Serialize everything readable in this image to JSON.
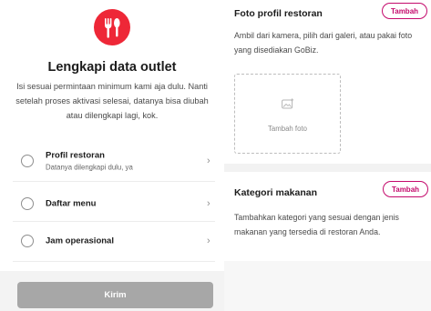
{
  "brand": {
    "accent": "#ee2737",
    "pill_color": "#c40a6c",
    "button_disabled": "#a7a7a7",
    "logo_icon": "fork-spoon-icon"
  },
  "left": {
    "title": "Lengkapi data outlet",
    "description": "Isi sesuai permintaan minimum kami aja dulu. Nanti setelah proses aktivasi selesai, datanya bisa diubah atau dilengkapi lagi, kok.",
    "items": [
      {
        "label": "Profil restoran",
        "sublabel": "Datanya dilengkapi dulu, ya",
        "chevron": "›"
      },
      {
        "label": "Daftar menu",
        "sublabel": "",
        "chevron": "›"
      },
      {
        "label": "Jam operasional",
        "sublabel": "",
        "chevron": "›"
      }
    ],
    "submit_label": "Kirim"
  },
  "right": {
    "photo_section": {
      "title": "Foto profil restoran",
      "action_label": "Tambah",
      "description": "Ambil dari kamera, pilih dari galeri, atau pakai foto yang disediakan GoBiz.",
      "add_photo_label": "Tambah foto",
      "add_photo_icon": "add-image-icon"
    },
    "category_section": {
      "title": "Kategori makanan",
      "action_label": "Tambah",
      "description": "Tambahkan kategori yang sesuai dengan jenis makanan yang tersedia di restoran Anda."
    }
  }
}
